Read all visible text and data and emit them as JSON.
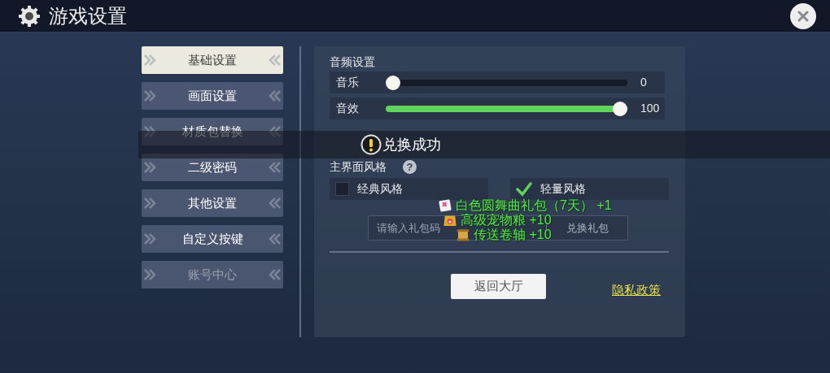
{
  "header": {
    "title": "游戏设置"
  },
  "sidebar": {
    "items": [
      {
        "label": "基础设置",
        "selected": true,
        "disabled": false
      },
      {
        "label": "画面设置",
        "selected": false,
        "disabled": false
      },
      {
        "label": "材质包替换",
        "selected": false,
        "disabled": false
      },
      {
        "label": "二级密码",
        "selected": false,
        "disabled": false
      },
      {
        "label": "其他设置",
        "selected": false,
        "disabled": false
      },
      {
        "label": "自定义按键",
        "selected": false,
        "disabled": false
      },
      {
        "label": "账号中心",
        "selected": false,
        "disabled": true
      }
    ]
  },
  "audio": {
    "title": "音频设置",
    "sliders": [
      {
        "label": "音乐",
        "level": 0,
        "reading": "0"
      },
      {
        "label": "音效",
        "level": 1,
        "reading": "100"
      }
    ]
  },
  "style": {
    "title": "主界面风格",
    "help_icon": "?",
    "options": [
      {
        "label": "经典风格",
        "checked": false
      },
      {
        "label": "轻量风格",
        "checked": true
      }
    ]
  },
  "gift": {
    "placeholder": "请输入礼包码",
    "button": "兑换礼包"
  },
  "back_button": "返回大厅",
  "privacy_link": "隐私政策",
  "toast": {
    "message": "兑换成功"
  },
  "rewards": [
    {
      "kind": "gift",
      "text": "白色圆舞曲礼包（7天） +1"
    },
    {
      "kind": "food",
      "text": "高级宠物粮 +10"
    },
    {
      "kind": "scroll",
      "text": "传送卷轴 +10"
    }
  ]
}
